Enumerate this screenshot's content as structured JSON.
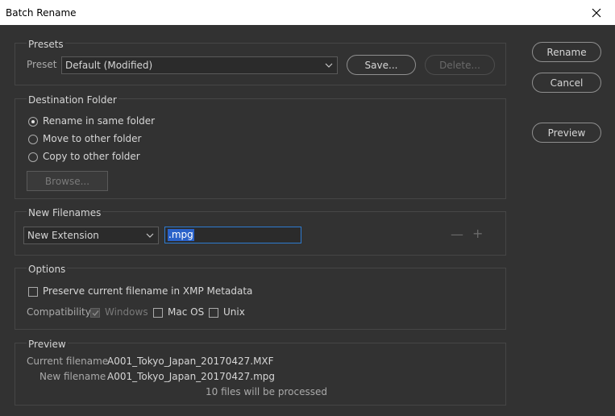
{
  "window": {
    "title": "Batch Rename"
  },
  "presets": {
    "legend": "Presets",
    "preset_label": "Preset",
    "preset_value": "Default (Modified)",
    "save_label": "Save...",
    "delete_label": "Delete..."
  },
  "actions": {
    "rename": "Rename",
    "cancel": "Cancel",
    "preview": "Preview"
  },
  "destination": {
    "legend": "Destination Folder",
    "options": [
      "Rename in same folder",
      "Move to other folder",
      "Copy to other folder"
    ],
    "selected_index": 0,
    "browse_label": "Browse..."
  },
  "new_filenames": {
    "legend": "New Filenames",
    "type_value": "New Extension",
    "extension_value": ".mpg",
    "minus": "—",
    "plus": "+"
  },
  "options": {
    "legend": "Options",
    "preserve_label": "Preserve current filename in XMP Metadata",
    "preserve_checked": false,
    "compat_label": "Compatibility",
    "windows_label": "Windows",
    "macos_label": "Mac OS",
    "unix_label": "Unix"
  },
  "preview": {
    "legend": "Preview",
    "current_label": "Current filename",
    "current_value": "A001_Tokyo_Japan_20170427.MXF",
    "new_label": "New filename",
    "new_value": "A001_Tokyo_Japan_20170427.mpg",
    "summary": "10 files will be processed"
  }
}
